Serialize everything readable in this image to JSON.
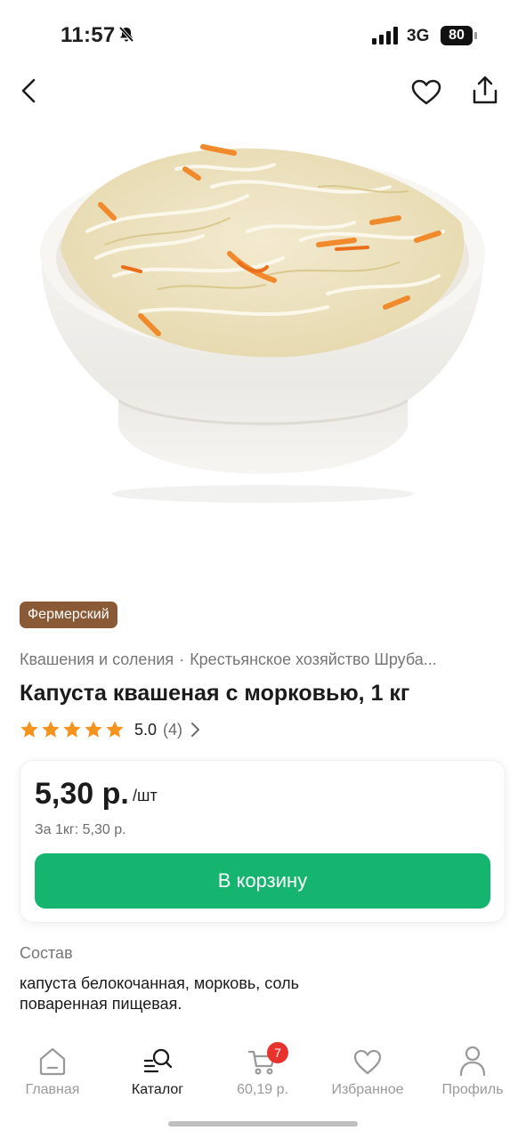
{
  "status_bar": {
    "time": "11:57",
    "network": "3G",
    "battery": "80"
  },
  "icons": {
    "back": "chevron-left-icon",
    "favorite": "heart-icon",
    "share": "share-icon",
    "bell_muted": "bell-slash-icon"
  },
  "product": {
    "badge": "Фермерский",
    "category": "Квашения и соления",
    "separator": "·",
    "producer": "Крестьянское хозяйство Шруба...",
    "title": "Капуста квашеная с морковью, 1 кг",
    "rating": {
      "stars": 5,
      "value": "5.0",
      "count": "(4)"
    },
    "price": "5,30 р.",
    "unit": "/шт",
    "price_per_kg": "За 1кг: 5,30 р.",
    "add_to_cart": "В корзину",
    "composition_label": "Состав",
    "composition": "капуста белокочанная, морковь, соль поваренная пищевая."
  },
  "tab_bar": {
    "home": "Главная",
    "catalog": "Каталог",
    "cart": "60,19 р.",
    "cart_badge": "7",
    "favorites": "Избранное",
    "profile": "Профиль",
    "active": "catalog"
  },
  "colors": {
    "accent_green": "#15b56f",
    "badge_brown": "#8a5a36",
    "star_orange": "#f5931f",
    "cart_badge_red": "#e8322c"
  }
}
